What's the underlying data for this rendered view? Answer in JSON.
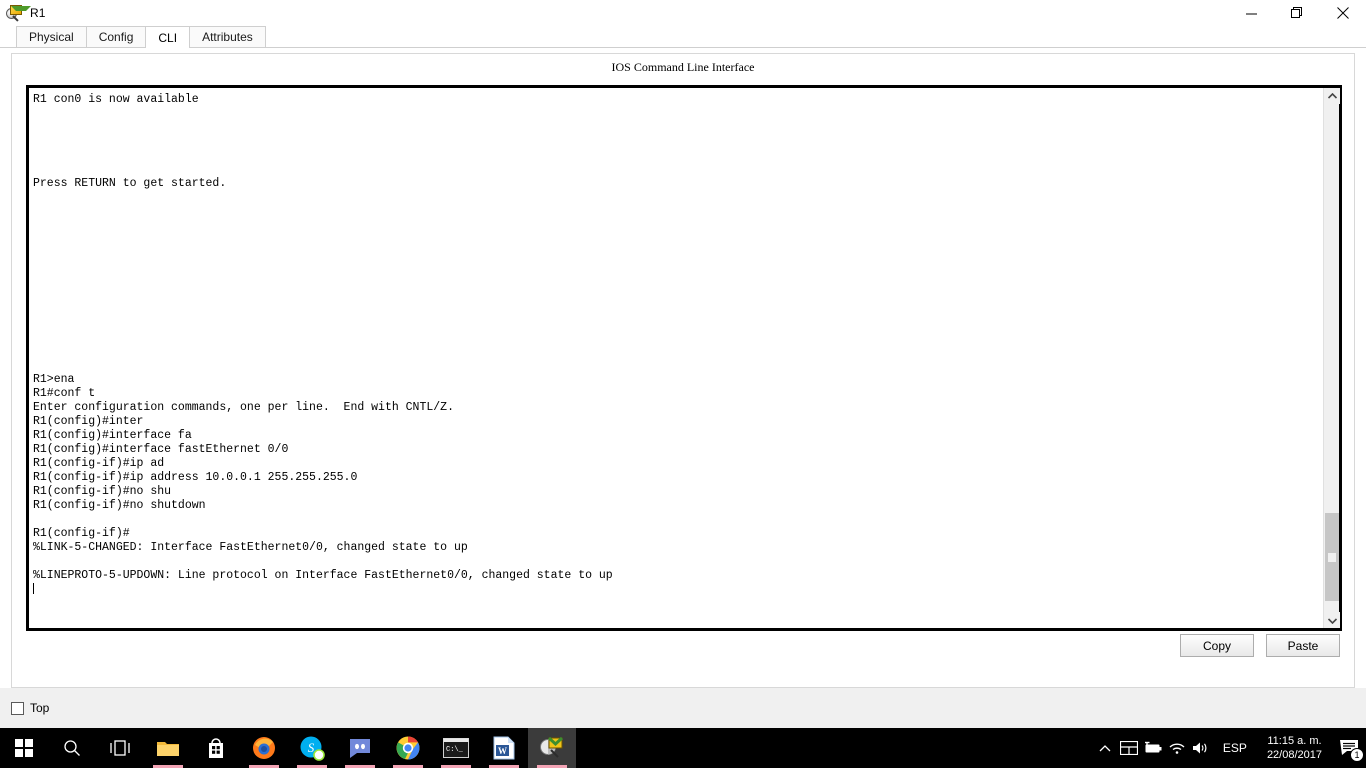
{
  "window": {
    "title": "R1",
    "icon": "packet-tracer-router-icon",
    "controls": {
      "minimize": "minimize-icon",
      "restore": "restore-icon",
      "close": "close-icon"
    }
  },
  "tabs": [
    {
      "label": "Physical",
      "active": false
    },
    {
      "label": "Config",
      "active": false
    },
    {
      "label": "CLI",
      "active": true
    },
    {
      "label": "Attributes",
      "active": false
    }
  ],
  "cli": {
    "header": "IOS Command Line Interface",
    "output": "R1 con0 is now available\n\n\n\n\n\nPress RETURN to get started.\n\n\n\n\n\n\n\n\n\n\n\n\n\nR1>ena\nR1#conf t\nEnter configuration commands, one per line.  End with CNTL/Z.\nR1(config)#inter\nR1(config)#interface fa\nR1(config)#interface fastEthernet 0/0\nR1(config-if)#ip ad\nR1(config-if)#ip address 10.0.0.1 255.255.255.0\nR1(config-if)#no shu\nR1(config-if)#no shutdown\n\nR1(config-if)#\n%LINK-5-CHANGED: Interface FastEthernet0/0, changed state to up\n\n%LINEPROTO-5-UPDOWN: Line protocol on Interface FastEthernet0/0, changed state to up\n",
    "scrollbar": {
      "up_arrow": "chevron-up-icon",
      "down_arrow": "chevron-down-icon"
    }
  },
  "actions": {
    "copy_label": "Copy",
    "paste_label": "Paste"
  },
  "bottom": {
    "top_checkbox_label": "Top",
    "top_checkbox_checked": false
  },
  "taskbar": {
    "items": [
      {
        "name": "start-button",
        "icon": "windows-logo-icon",
        "active": false
      },
      {
        "name": "search-button",
        "icon": "search-icon",
        "active": false
      },
      {
        "name": "task-view-button",
        "icon": "task-view-icon",
        "active": false
      },
      {
        "name": "file-explorer",
        "icon": "folder-icon",
        "active": false
      },
      {
        "name": "microsoft-store",
        "icon": "store-bag-icon",
        "active": false
      },
      {
        "name": "firefox",
        "icon": "firefox-icon",
        "active": false
      },
      {
        "name": "skype",
        "icon": "skype-icon",
        "active": false
      },
      {
        "name": "discord",
        "icon": "discord-icon",
        "active": false
      },
      {
        "name": "google-chrome",
        "icon": "chrome-icon",
        "active": false
      },
      {
        "name": "command-prompt",
        "icon": "console-icon",
        "active": false
      },
      {
        "name": "microsoft-word",
        "icon": "word-icon",
        "active": false
      },
      {
        "name": "packet-tracer",
        "icon": "packet-tracer-icon",
        "active": true
      }
    ],
    "tray": {
      "show_hidden": "chevron-up-icon",
      "icons": [
        "action-center-icon",
        "battery-icon",
        "wifi-icon",
        "volume-icon"
      ],
      "language": "ESP",
      "time": "11:15 a. m.",
      "date": "22/08/2017",
      "notification_icon": "notification-icon",
      "notification_count": "1"
    }
  },
  "colors": {
    "taskbar_bg": "#000000",
    "panel_bg": "#f0f0f0",
    "terminal_border": "#000000",
    "active_indicator": "#f3a4b5"
  }
}
